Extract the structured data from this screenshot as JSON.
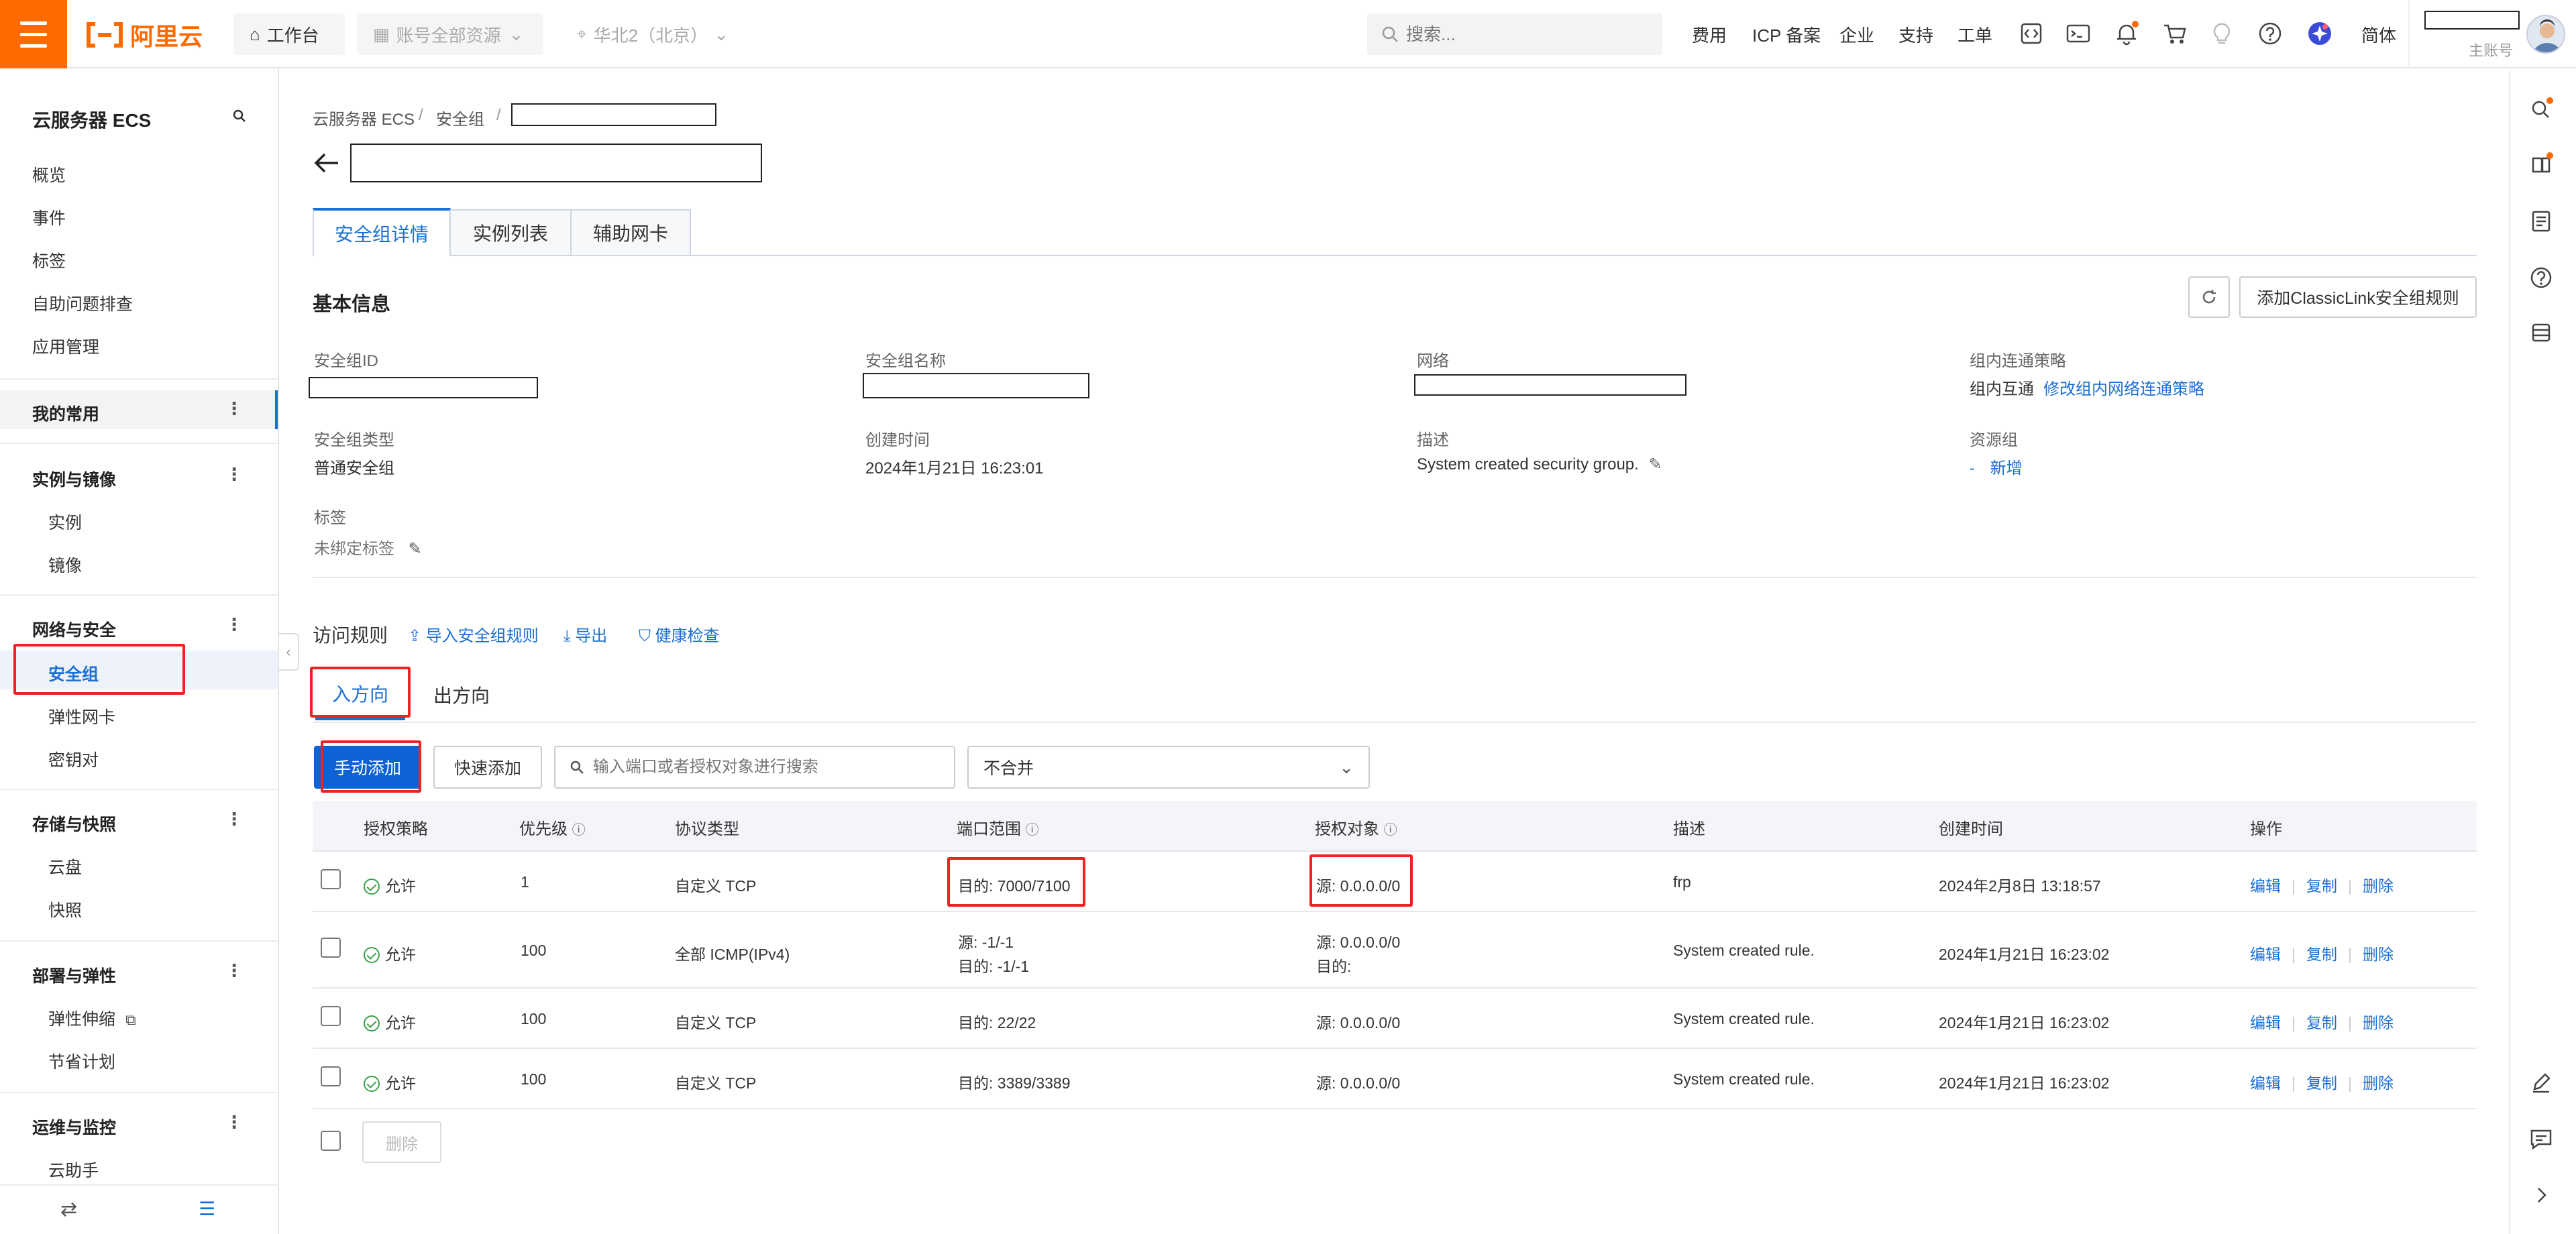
{
  "topbar": {
    "logo": "阿里云",
    "workbench": "工作台",
    "account_resources": "账号全部资源",
    "region": "华北2（北京）",
    "search_placeholder": "搜索...",
    "links": [
      "费用",
      "ICP 备案",
      "企业",
      "支持",
      "工单"
    ],
    "lang": "简体",
    "account_sub": "主账号"
  },
  "sidebar": {
    "title": "云服务器 ECS",
    "top_items": [
      "概览",
      "事件",
      "标签",
      "自助问题排查",
      "应用管理"
    ],
    "favorites": "我的常用",
    "groups": [
      {
        "title": "实例与镜像",
        "items": [
          "实例",
          "镜像"
        ]
      },
      {
        "title": "网络与安全",
        "items": [
          "安全组",
          "弹性网卡",
          "密钥对"
        ]
      },
      {
        "title": "存储与快照",
        "items": [
          "云盘",
          "快照"
        ]
      },
      {
        "title": "部署与弹性",
        "items": [
          "弹性伸缩",
          "节省计划"
        ]
      },
      {
        "title": "运维与监控",
        "items": [
          "云助手"
        ]
      }
    ],
    "active_item": "安全组"
  },
  "breadcrumb": [
    "云服务器 ECS",
    "安全组"
  ],
  "tabs": [
    "安全组详情",
    "实例列表",
    "辅助网卡"
  ],
  "basic_info": {
    "title": "基本信息",
    "add_classiclink_button": "添加ClassicLink安全组规则",
    "fields": {
      "sg_id_label": "安全组ID",
      "sg_name_label": "安全组名称",
      "network_label": "网络",
      "policy_label": "组内连通策略",
      "policy_value": "组内互通",
      "policy_link": "修改组内网络连通策略",
      "type_label": "安全组类型",
      "type_value": "普通安全组",
      "created_label": "创建时间",
      "created_value": "2024年1月21日 16:23:01",
      "desc_label": "描述",
      "desc_value": "System created security group.",
      "rg_label": "资源组",
      "rg_dash": "-",
      "rg_link": "新增",
      "tag_label": "标签",
      "tag_value": "未绑定标签"
    }
  },
  "access_rules": {
    "title": "访问规则",
    "import": "导入安全组规则",
    "export": "导出",
    "health": "健康检查",
    "direction_tabs": [
      "入方向",
      "出方向"
    ],
    "manual_add": "手动添加",
    "quick_add": "快速添加",
    "search_placeholder": "输入端口或者授权对象进行搜索",
    "merge_select": "不合并",
    "columns": [
      "授权策略",
      "优先级",
      "协议类型",
      "端口范围",
      "授权对象",
      "描述",
      "创建时间",
      "操作"
    ],
    "rows": [
      {
        "policy": "允许",
        "priority": "1",
        "protocol": "自定义 TCP",
        "port": [
          "目的: 7000/7100"
        ],
        "source": [
          "源: 0.0.0.0/0"
        ],
        "desc": "frp",
        "created": "2024年2月8日 13:18:57"
      },
      {
        "policy": "允许",
        "priority": "100",
        "protocol": "全部 ICMP(IPv4)",
        "port": [
          "源: -1/-1",
          "目的: -1/-1"
        ],
        "source": [
          "源: 0.0.0.0/0",
          "目的:"
        ],
        "desc": "System created rule.",
        "created": "2024年1月21日 16:23:02"
      },
      {
        "policy": "允许",
        "priority": "100",
        "protocol": "自定义 TCP",
        "port": [
          "目的: 22/22"
        ],
        "source": [
          "源: 0.0.0.0/0"
        ],
        "desc": "System created rule.",
        "created": "2024年1月21日 16:23:02"
      },
      {
        "policy": "允许",
        "priority": "100",
        "protocol": "自定义 TCP",
        "port": [
          "目的: 3389/3389"
        ],
        "source": [
          "源: 0.0.0.0/0"
        ],
        "desc": "System created rule.",
        "created": "2024年1月21日 16:23:02"
      }
    ],
    "actions": [
      "编辑",
      "复制",
      "删除"
    ],
    "bulk_delete": "删除"
  },
  "colors": {
    "brand": "#ff6a00",
    "accent": "#1a6fd4",
    "primary_button": "#0c62d6",
    "highlight": "#e22222",
    "ok": "#3aa04a"
  }
}
